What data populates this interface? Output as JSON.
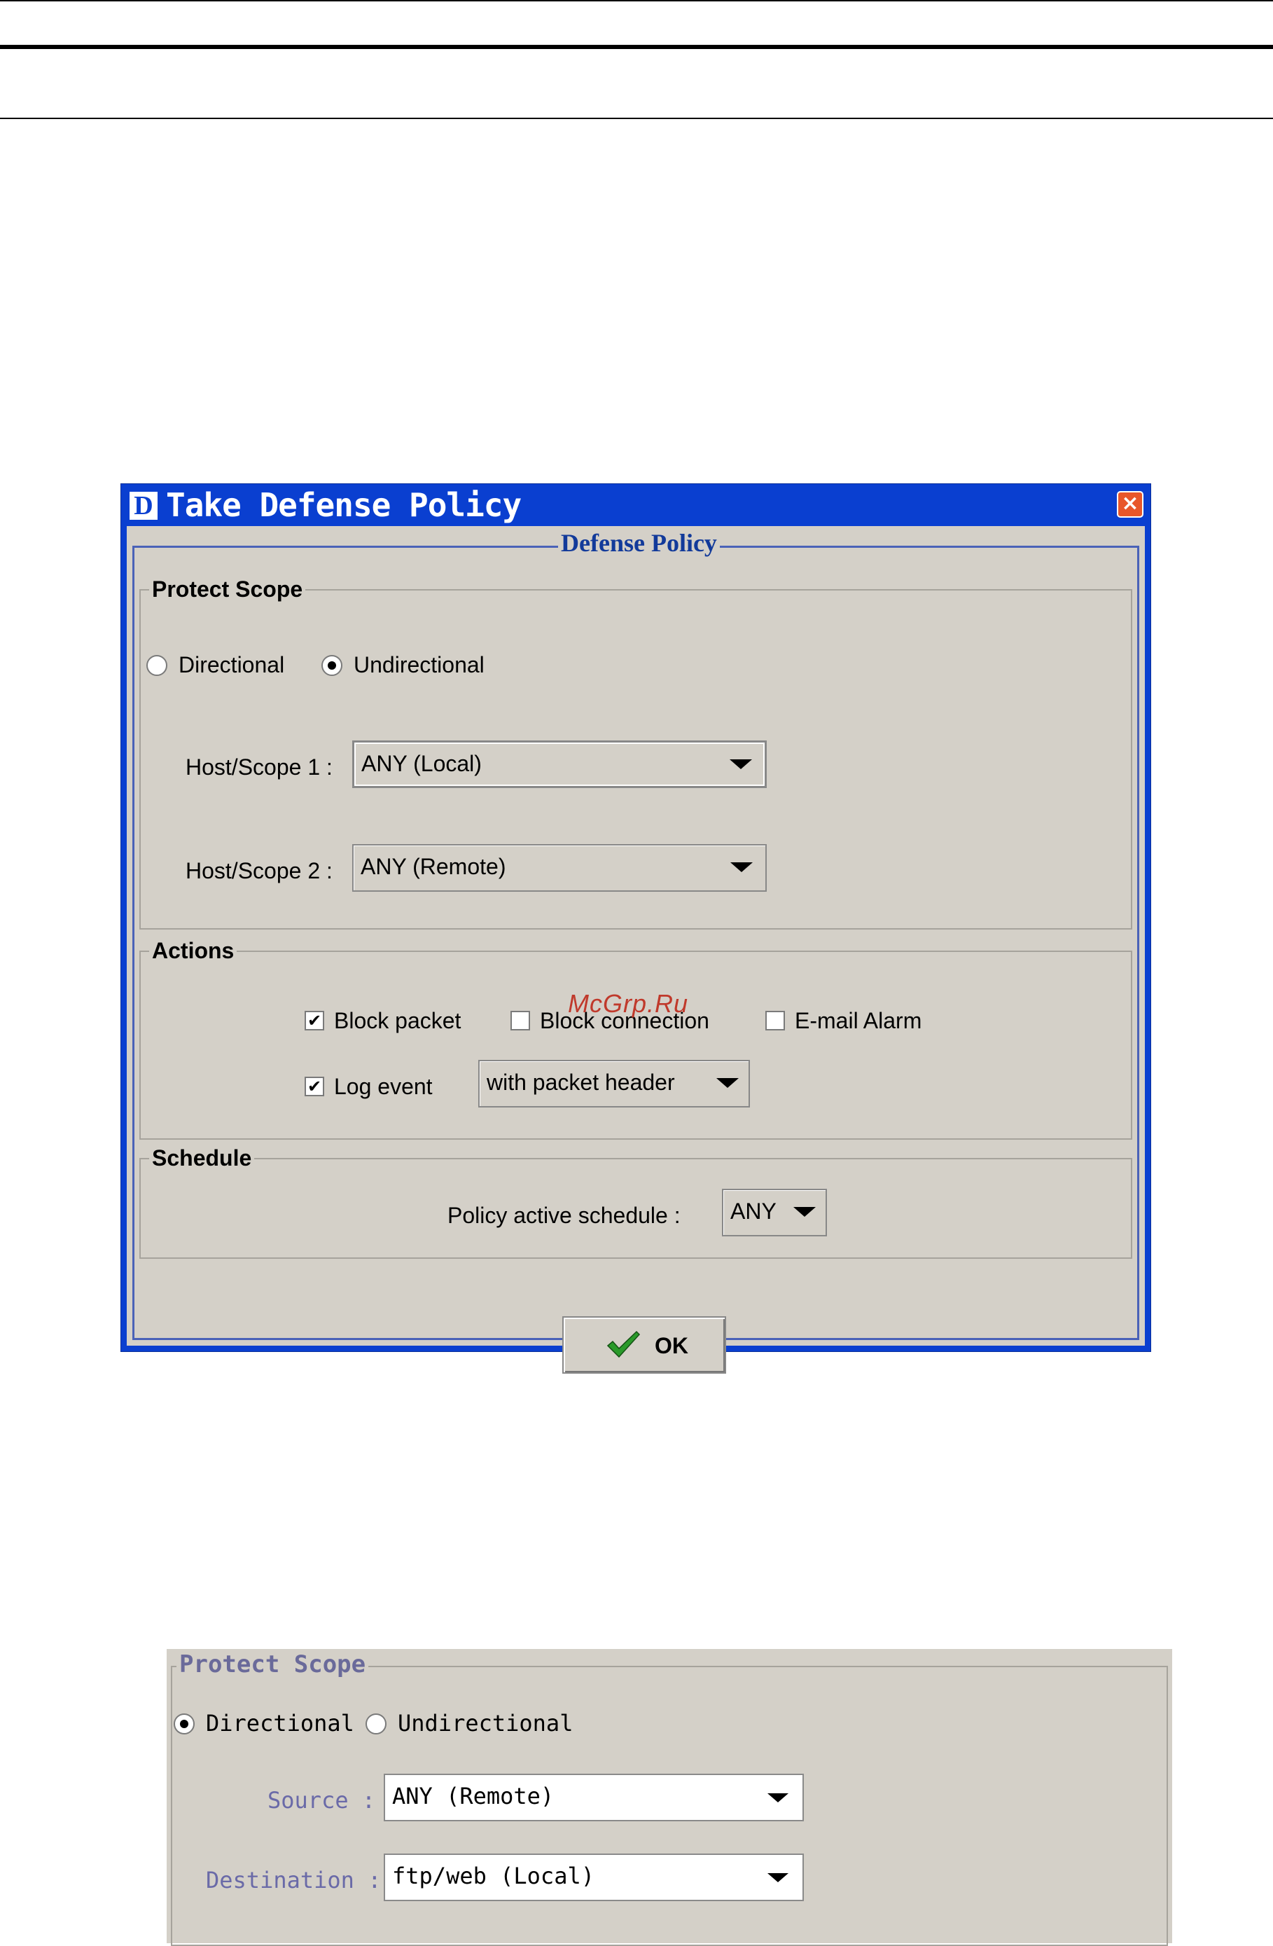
{
  "dialog": {
    "logo_letter": "D",
    "title": "Take Defense Policy",
    "close_glyph": "×",
    "legend": "Defense Policy",
    "protect_scope": {
      "legend": "Protect Scope",
      "radio_directional": "Directional",
      "radio_undirectional": "Undirectional",
      "selected": "Undirectional",
      "host1_label": "Host/Scope 1 :",
      "host1_value": "ANY (Local)",
      "host2_label": "Host/Scope 2 :",
      "host2_value": "ANY (Remote)"
    },
    "actions": {
      "legend": "Actions",
      "block_packet": "Block packet",
      "block_packet_checked": true,
      "block_connection": "Block connection",
      "block_connection_checked": false,
      "email_alarm": "E-mail Alarm",
      "email_alarm_checked": false,
      "log_event": "Log event",
      "log_event_checked": true,
      "log_mode_value": "with packet header"
    },
    "schedule": {
      "legend": "Schedule",
      "label": "Policy active schedule :",
      "value": "ANY"
    },
    "ok_label": "OK",
    "check_mark": "✔"
  },
  "watermark": "McGrp.Ru",
  "panel2": {
    "legend": "Protect Scope",
    "radio_directional": "Directional",
    "radio_undirectional": "Undirectional",
    "selected": "Directional",
    "source_label": "Source :",
    "source_value": "ANY (Remote)",
    "destination_label": "Destination :",
    "destination_value": "ftp/web (Local)"
  },
  "colors": {
    "title_bar": "#0a3fd0",
    "dialog_bg": "#d4d0c8",
    "legend_blue": "#123a9a",
    "watermark": "#c0392b",
    "close_button": "#e8562a",
    "ok_check": "#2a9a2a"
  }
}
